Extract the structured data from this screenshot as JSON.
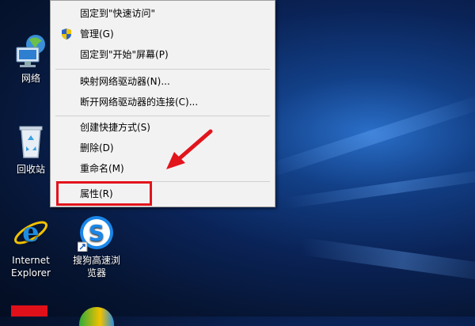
{
  "desktop": {
    "icons": [
      {
        "name": "network",
        "label": "网络"
      },
      {
        "name": "recycle-bin",
        "label": "回收站"
      },
      {
        "name": "internet-explorer",
        "label_line1": "Internet",
        "label_line2": "Explorer"
      },
      {
        "name": "sogou-browser",
        "label_line1": "搜狗高速浏",
        "label_line2": "览器"
      }
    ]
  },
  "context_menu": {
    "items": [
      {
        "label": "固定到\"快速访问\""
      },
      {
        "label": "管理(G)",
        "icon": "uac-shield-icon"
      },
      {
        "label": "固定到\"开始\"屏幕(P)"
      },
      {
        "label": "映射网络驱动器(N)..."
      },
      {
        "label": "断开网络驱动器的连接(C)..."
      },
      {
        "label": "创建快捷方式(S)"
      },
      {
        "label": "删除(D)"
      },
      {
        "label": "重命名(M)"
      },
      {
        "label": "属性(R)",
        "highlighted": true
      }
    ]
  },
  "colors": {
    "highlight_box": "#e2141c",
    "arrow": "#e2141c"
  }
}
